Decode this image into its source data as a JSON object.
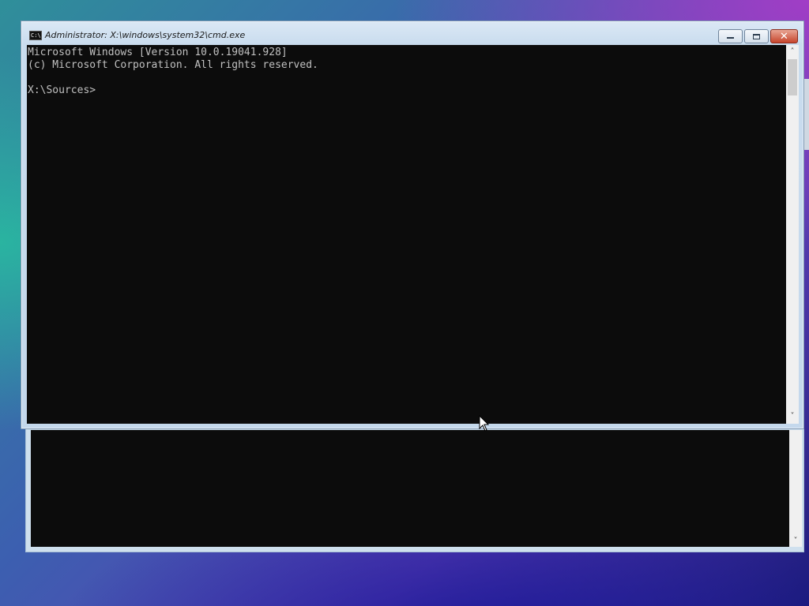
{
  "window": {
    "title": "Administrator: X:\\windows\\system32\\cmd.exe",
    "icon": "cmd-icon",
    "icon_text": "C:\\"
  },
  "controls": {
    "minimize": "minimize-icon",
    "maximize": "maximize-icon",
    "close": "close-icon",
    "close_glyph": "✕"
  },
  "console": {
    "lines": [
      "Microsoft Windows [Version 10.0.19041.928]",
      "(c) Microsoft Corporation. All rights reserved.",
      "",
      "X:\\Sources>"
    ],
    "text_color": "#c0c0c0",
    "background": "#0c0c0c"
  },
  "scrollbar": {
    "up_arrow": "˄",
    "down_arrow": "˅"
  },
  "background_window": {
    "down_arrow": "˅"
  }
}
